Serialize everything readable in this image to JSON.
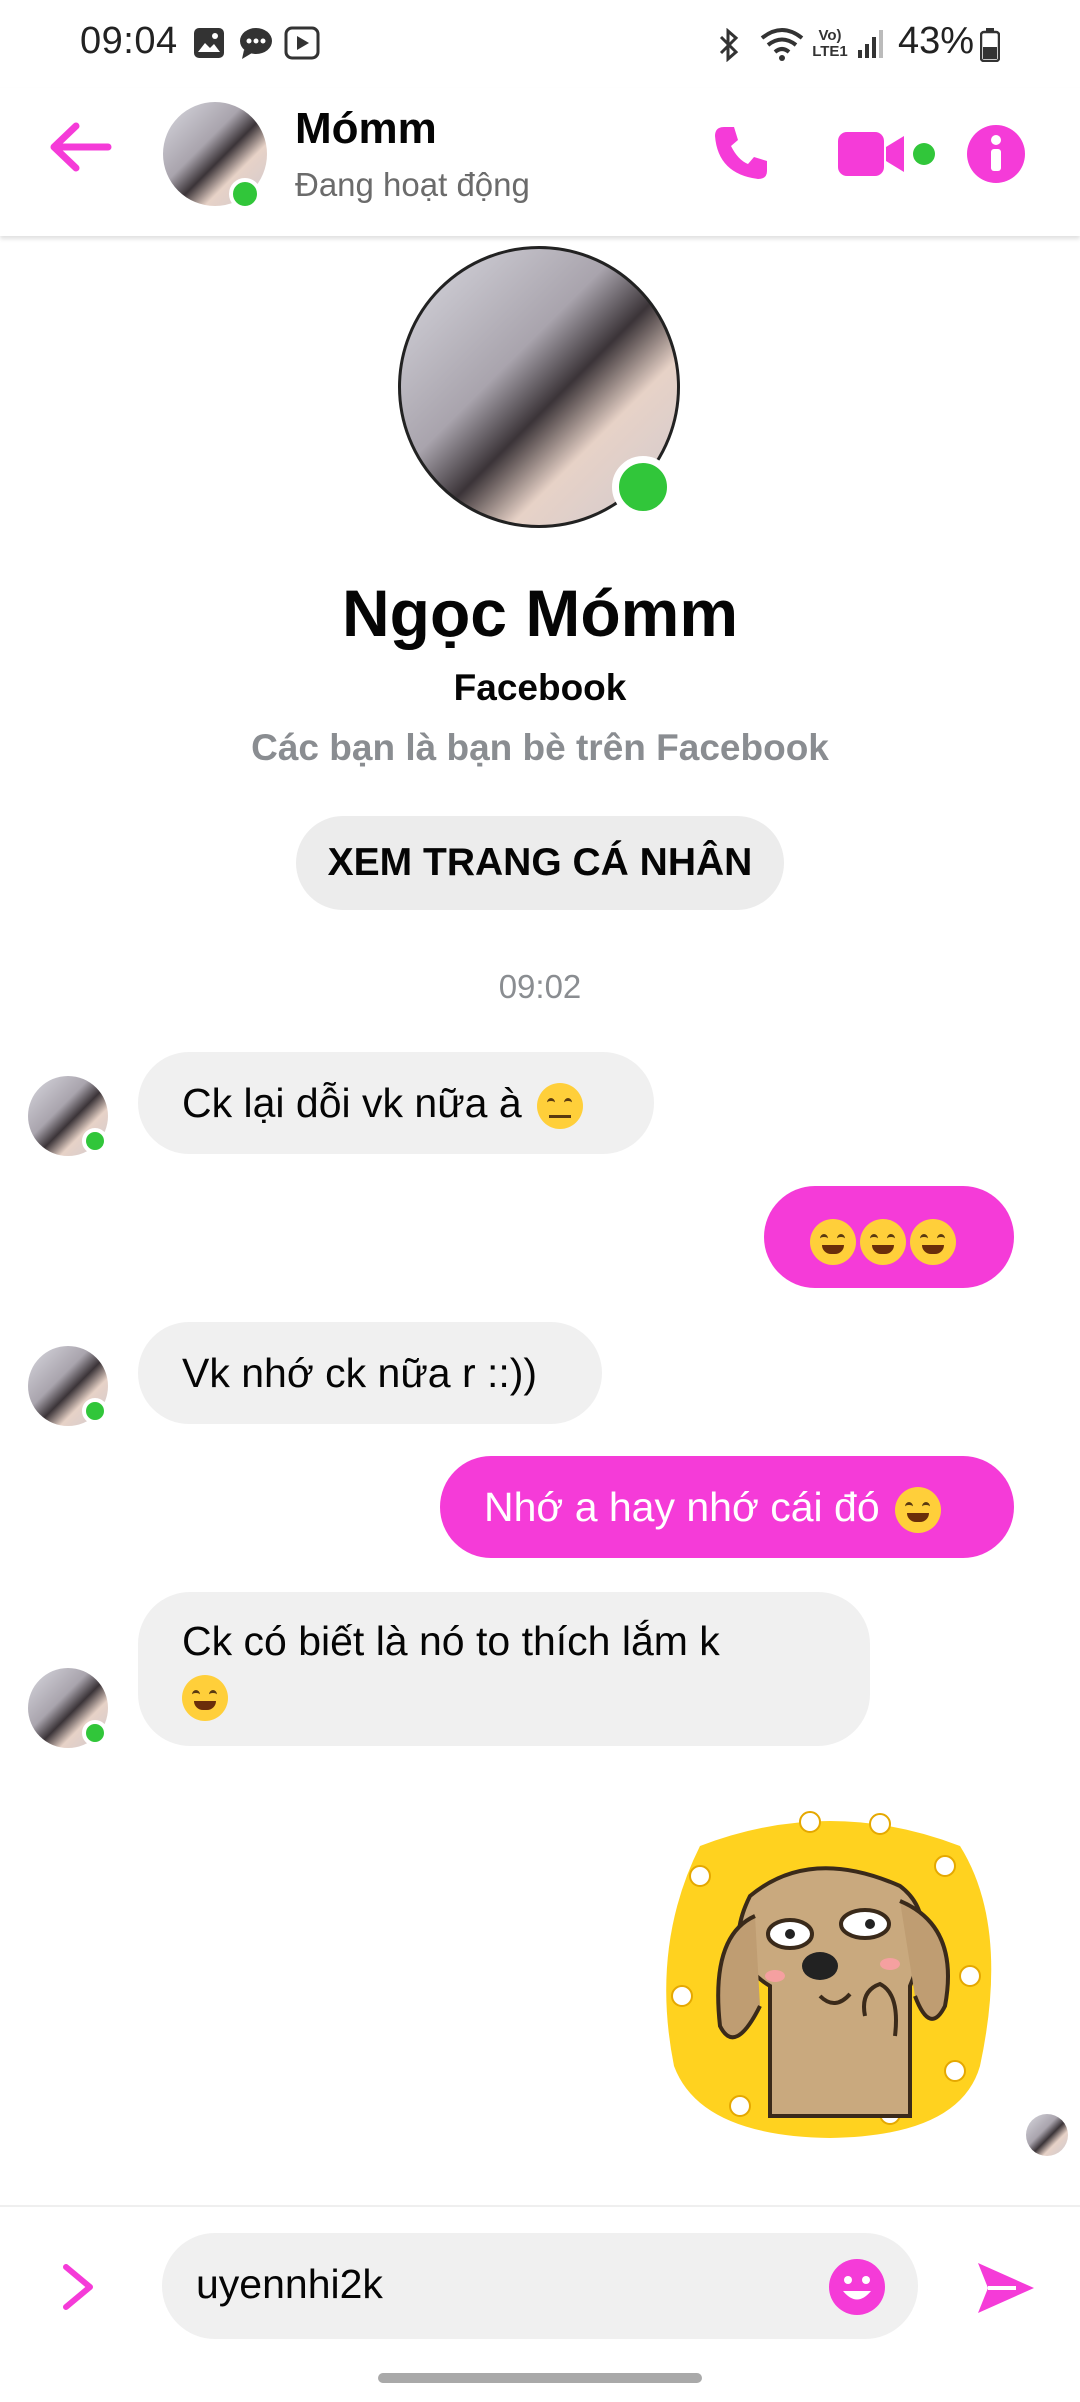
{
  "status_bar": {
    "time": "09:04",
    "network_label": "Vo) LTE1",
    "battery": "43%"
  },
  "header": {
    "name": "Mómm",
    "status": "Đang hoạt động",
    "accent": "#f53bd8"
  },
  "profile": {
    "name": "Ngọc Mómm",
    "platform": "Facebook",
    "subtitle": "Các bạn là bạn bè trên Facebook",
    "view_profile_label": "XEM TRANG CÁ NHÂN"
  },
  "time_separator": "09:02",
  "messages": [
    {
      "direction": "in",
      "text": "Ck lại dỗi vk nữa à",
      "emoji": "unamused"
    },
    {
      "direction": "out",
      "text": "",
      "emoji": "laughing x3"
    },
    {
      "direction": "in",
      "text": "Vk nhớ ck nữa r ::))",
      "emoji": ""
    },
    {
      "direction": "out",
      "text": "Nhớ a hay nhớ cái đó",
      "emoji": "grinning"
    },
    {
      "direction": "in",
      "text": "Ck có biết là nó to thích lắm k",
      "emoji": "winking"
    },
    {
      "direction": "out",
      "text": "",
      "emoji": "sticker-dog"
    }
  ],
  "composer": {
    "value": "uyennhi2k"
  }
}
